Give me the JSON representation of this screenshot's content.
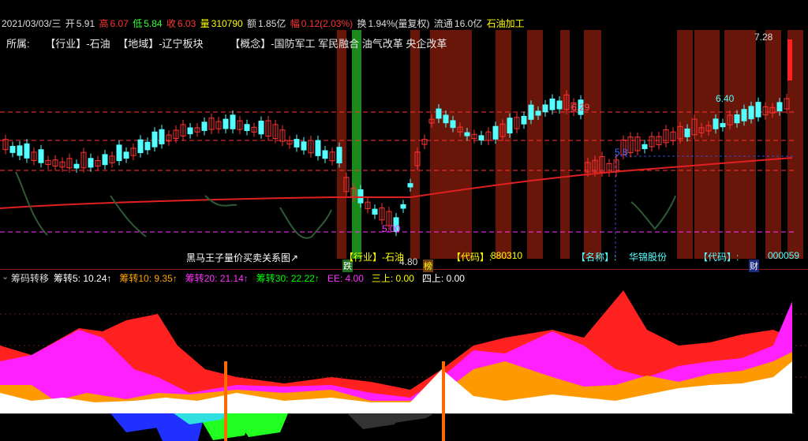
{
  "infobar": {
    "date": "2021/03/03/三",
    "open_label": "开",
    "open": "5.91",
    "high_label": "高",
    "high": "6.07",
    "low_label": "低",
    "low": "5.84",
    "close_label": "收",
    "close": "6.03",
    "vol_label": "量",
    "vol": "310790",
    "amount_label": "额",
    "amount": "1.85亿",
    "change_label": "幅",
    "change": "0.12(2.03%)",
    "turnover_label": "换",
    "turnover": "1.94%(量复权)",
    "float_label": "流通",
    "float": "16.0亿",
    "sector": "石油加工"
  },
  "belongs": {
    "prefix": "所属:",
    "industry": "【行业】-石油",
    "region": "【地域】-辽宁板块",
    "concept": "【概念】-国防军工 军民融合 油气改革 央企改革"
  },
  "main": {
    "price_labels": {
      "p728": "7.28",
      "p640": "6.40",
      "p629": "6.29",
      "p500": "5.00",
      "p580": "5.8",
      "p480": "4.80"
    },
    "markers": {
      "die": "跌",
      "bang": "榜",
      "cai": "财"
    },
    "bottom_texts": {
      "heima": "黑马王子量价买卖关系图↗",
      "industry_tag": "【行业】-石油",
      "code_label": "【代码】:",
      "code_value": "880310",
      "name_label": "【名称】:",
      "name_value": "华锦股份",
      "code2_label": "【代码】:",
      "code2_value": "000059"
    }
  },
  "sub": {
    "title": "筹码转移",
    "items": [
      {
        "label": "筹转5:",
        "value": "10.24",
        "color": "#ffffff"
      },
      {
        "label": "筹转10:",
        "value": "9.35",
        "color": "#ffa500"
      },
      {
        "label": "筹转20:",
        "value": "21.14",
        "color": "#ff33ff"
      },
      {
        "label": "筹转30:",
        "value": "22.22",
        "color": "#00ff00"
      },
      {
        "label": "EE:",
        "value": "4.00",
        "color": "#ff33ff"
      },
      {
        "label": "三上:",
        "value": "0.00",
        "color": "#ffff00"
      },
      {
        "label": "四上:",
        "value": "0.00",
        "color": "#ffffff"
      }
    ]
  },
  "colors": {
    "up": "#ff3333",
    "down": "#54ffff",
    "ma": "#e02020",
    "bg_band": "#7a1a0a"
  }
}
